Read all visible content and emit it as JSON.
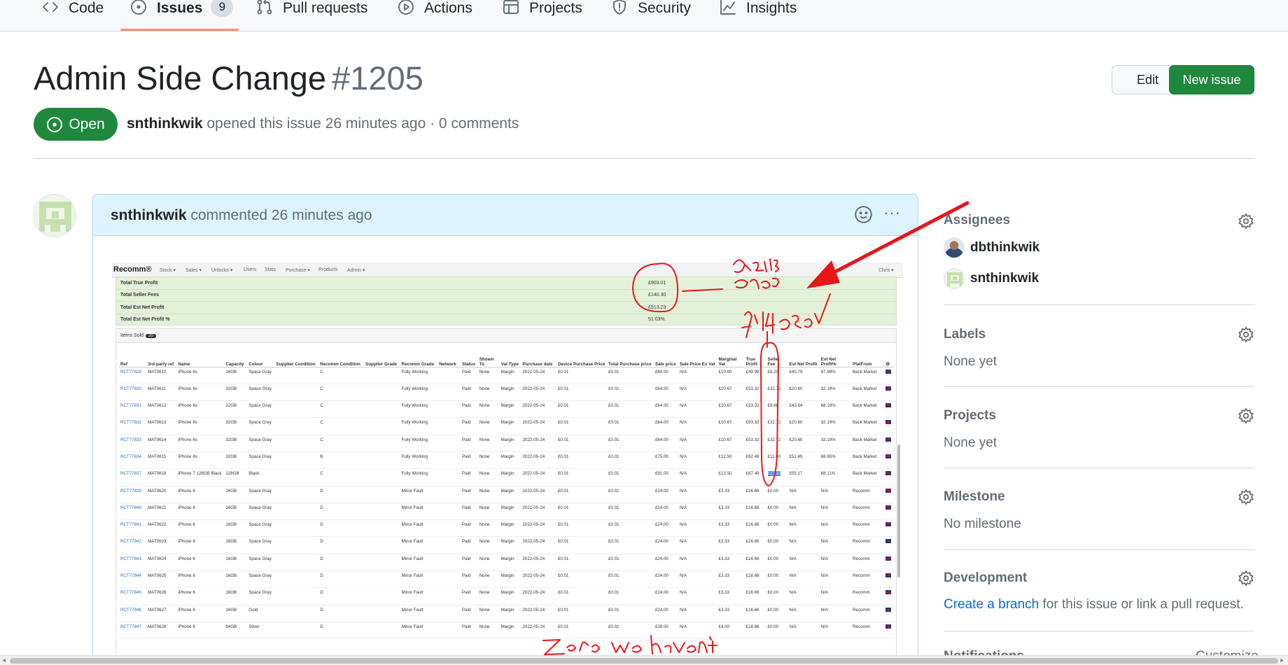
{
  "nav": {
    "tabs": [
      {
        "label": "Code",
        "icon": "code-icon"
      },
      {
        "label": "Issues",
        "icon": "issue-opened-icon",
        "count": "9",
        "active": true
      },
      {
        "label": "Pull requests",
        "icon": "git-pull-request-icon"
      },
      {
        "label": "Actions",
        "icon": "play-icon"
      },
      {
        "label": "Projects",
        "icon": "table-icon"
      },
      {
        "label": "Security",
        "icon": "shield-icon"
      },
      {
        "label": "Insights",
        "icon": "graph-icon"
      }
    ]
  },
  "issue": {
    "title": "Admin Side Change",
    "number": "#1205",
    "state": "Open",
    "author": "snthinkwik",
    "meta": "opened this issue 26 minutes ago · 0 comments",
    "edit_label": "Edit",
    "new_issue_label": "New issue"
  },
  "comment": {
    "author": "snthinkwik",
    "meta": "commented 26 minutes ago",
    "more": "···"
  },
  "screenshot": {
    "brand": "Recomm®",
    "nav": [
      "Stock ▾",
      "Sales ▾",
      "Unlocks ▾",
      "Users",
      "Stats",
      "Purchase ▾",
      "Products",
      "Admin ▾"
    ],
    "user": "Chris ▾",
    "summary": [
      {
        "label": "Total True Profit",
        "value": "£903.01"
      },
      {
        "label": "Total Seller Fees",
        "value": "£140.30"
      },
      {
        "label": "Total Est Net Profit",
        "value": "£513.23"
      },
      {
        "label": "Total Est Net Profit %",
        "value": "51.03%"
      }
    ],
    "items_title": "Items Sold",
    "items_count": "20",
    "columns": [
      "Ref",
      "3rd-party ref",
      "Name",
      "Capacity",
      "Colour",
      "Supplier Condition",
      "Recomm Condition",
      "Supplier Grade",
      "Recomm Grade",
      "Network",
      "Status",
      "Shown To",
      "Vat Type",
      "Purchase date",
      "Device Purchase Price",
      "Total Purchase price",
      "Sale price",
      "Sale Price Ex Vat",
      "Marginal Vat",
      "True Profit",
      "Seller Fee",
      "Est Net Profit",
      "Est Net Profit%",
      "PlatFrom",
      "⚙"
    ],
    "rows": [
      [
        "RCT77829",
        "MAT0610",
        "iPhone 6s",
        "16GB",
        "Space Gray",
        "",
        "C",
        "",
        "Fully Working",
        "",
        "Paid",
        "None",
        "Margin",
        "2022-05-24",
        "£0.01",
        "£0.01",
        "£60.00",
        "N/A",
        "£10.00",
        "£49.99",
        "£9.20",
        "£40.79",
        "67.98%",
        "Back Market"
      ],
      [
        "RCT77830",
        "MAT0611",
        "iPhone 6s",
        "32GB",
        "Space Gray",
        "",
        "C",
        "",
        "Fully Working",
        "",
        "Paid",
        "None",
        "Margin",
        "2022-05-24",
        "£0.01",
        "£0.01",
        "£64.00",
        "N/A",
        "£10.67",
        "£53.32",
        "£32.72",
        "£20.60",
        "32.19%",
        "Back Market"
      ],
      [
        "RCT77831",
        "MAT0612",
        "iPhone 6s",
        "32GB",
        "Space Gray",
        "",
        "C",
        "",
        "Fully Working",
        "",
        "Paid",
        "None",
        "Margin",
        "2022-05-24",
        "£0.01",
        "£0.01",
        "£64.00",
        "N/A",
        "£10.67",
        "£53.32",
        "£9.68",
        "£43.64",
        "68.19%",
        "Back Market"
      ],
      [
        "RCT77832",
        "MAT0613",
        "iPhone 6s",
        "32GB",
        "Space Gray",
        "",
        "C",
        "",
        "Fully Working",
        "",
        "Paid",
        "None",
        "Margin",
        "2022-05-24",
        "£0.01",
        "£0.01",
        "£64.00",
        "N/A",
        "£10.67",
        "£53.32",
        "£32.72",
        "£20.60",
        "32.19%",
        "Back Market"
      ],
      [
        "RCT77833",
        "MAT0614",
        "iPhone 6s",
        "32GB",
        "Space Gray",
        "",
        "C",
        "",
        "Fully Working",
        "",
        "Paid",
        "None",
        "Margin",
        "2022-05-24",
        "£0.01",
        "£0.01",
        "£64.00",
        "N/A",
        "£10.67",
        "£53.32",
        "£32.72",
        "£20.60",
        "32.19%",
        "Back Market"
      ],
      [
        "RCT77834",
        "MAT0615",
        "iPhone 6s",
        "32GB",
        "Space Gray",
        "",
        "B",
        "",
        "Fully Working",
        "",
        "Paid",
        "None",
        "Margin",
        "2022-05-24",
        "£0.01",
        "£0.01",
        "£75.00",
        "N/A",
        "£12.50",
        "£62.49",
        "£11.00",
        "£51.49",
        "68.65%",
        "Back Market"
      ],
      [
        "RCT77837",
        "MAT0618",
        "iPhone 7 128GB Black",
        "128GB",
        "Black",
        "",
        "C",
        "",
        "Fully Working",
        "",
        "Paid",
        "None",
        "Margin",
        "2022-05-24",
        "£0.01",
        "£0.01",
        "£81.00",
        "N/A",
        "£13.50",
        "£67.49",
        "£12.32",
        "£55.17",
        "68.11%",
        "Back Market"
      ],
      [
        "RCT77839",
        "MAT0620",
        "iPhone 6",
        "16GB",
        "Space Gray",
        "",
        "D",
        "",
        "Minor Fault",
        "",
        "Paid",
        "None",
        "Margin",
        "2022-05-24",
        "£0.01",
        "£0.01",
        "£24.00",
        "N/A",
        "£3.33",
        "£16.66",
        "£0.00",
        "N/A",
        "N/A",
        "Recomm"
      ],
      [
        "RCT77840",
        "MAT0621",
        "iPhone 6",
        "16GB",
        "Space Gray",
        "",
        "D",
        "",
        "Minor Fault",
        "",
        "Paid",
        "None",
        "Margin",
        "2022-05-24",
        "£0.01",
        "£0.01",
        "£24.00",
        "N/A",
        "£3.33",
        "£16.66",
        "£0.00",
        "N/A",
        "N/A",
        "Recomm"
      ],
      [
        "RCT77841",
        "MAT0622",
        "iPhone 6",
        "16GB",
        "Space Gray",
        "",
        "D",
        "",
        "Minor Fault",
        "",
        "Paid",
        "None",
        "Margin",
        "2022-05-24",
        "£0.01",
        "£0.01",
        "£24.00",
        "N/A",
        "£3.33",
        "£16.66",
        "£0.00",
        "N/A",
        "N/A",
        "Recomm"
      ],
      [
        "RCT77842",
        "MAT0623",
        "iPhone 6",
        "16GB",
        "Space Gray",
        "",
        "D",
        "",
        "Minor Fault",
        "",
        "Paid",
        "None",
        "Margin",
        "2022-05-24",
        "£0.01",
        "£0.01",
        "£24.00",
        "N/A",
        "£3.33",
        "£16.66",
        "£0.00",
        "N/A",
        "N/A",
        "Recomm"
      ],
      [
        "RCT77843",
        "MAT0624",
        "iPhone 6",
        "16GB",
        "Space Gray",
        "",
        "D",
        "",
        "Minor Fault",
        "",
        "Paid",
        "None",
        "Margin",
        "2022-05-24",
        "£0.01",
        "£0.01",
        "£24.00",
        "N/A",
        "£3.33",
        "£16.66",
        "£0.00",
        "N/A",
        "N/A",
        "Recomm"
      ],
      [
        "RCT77844",
        "MAT0625",
        "iPhone 6",
        "16GB",
        "Space Gray",
        "",
        "D",
        "",
        "Minor Fault",
        "",
        "Paid",
        "None",
        "Margin",
        "2022-05-24",
        "£0.01",
        "£0.01",
        "£24.00",
        "N/A",
        "£3.33",
        "£16.66",
        "£0.00",
        "N/A",
        "N/A",
        "Recomm"
      ],
      [
        "RCT77845",
        "MAT0626",
        "iPhone 6",
        "16GB",
        "Space Gray",
        "",
        "D",
        "",
        "Minor Fault",
        "",
        "Paid",
        "None",
        "Margin",
        "2022-05-24",
        "£0.01",
        "£0.01",
        "£24.00",
        "N/A",
        "£3.33",
        "£16.66",
        "£0.00",
        "N/A",
        "N/A",
        "Recomm"
      ],
      [
        "RCT77846",
        "MAT0627",
        "iPhone 6",
        "16GB",
        "Gold",
        "",
        "D",
        "",
        "Minor Fault",
        "",
        "Paid",
        "None",
        "Margin",
        "2022-05-24",
        "£0.01",
        "£0.01",
        "£24.00",
        "N/A",
        "£3.33",
        "£16.66",
        "£0.00",
        "N/A",
        "N/A",
        "Recomm"
      ],
      [
        "RCT77847",
        "MAT0628",
        "iPhone 6",
        "64GB",
        "Silver",
        "",
        "D",
        "",
        "Minor Fault",
        "",
        "Paid",
        "None",
        "Margin",
        "2022-05-24",
        "£0.01",
        "£0.01",
        "£28.00",
        "N/A",
        "£4.00",
        "£18.66",
        "£0.00",
        "N/A",
        "N/A",
        "Recomm"
      ]
    ],
    "highlight_text": "12.32",
    "annotations": [
      "doesn't add up",
      "£140.36",
      "Zero we haven't"
    ]
  },
  "sidebar": {
    "assignees_title": "Assignees",
    "assignees": [
      "dbthinkwik",
      "snthinkwik"
    ],
    "labels_title": "Labels",
    "labels_value": "None yet",
    "projects_title": "Projects",
    "projects_value": "None yet",
    "milestone_title": "Milestone",
    "milestone_value": "No milestone",
    "development_title": "Development",
    "development_link": "Create a branch",
    "development_rest": " for this issue or link a pull request.",
    "notifications_title": "Notifications",
    "notifications_action": "Customize"
  },
  "colors": {
    "accent_green": "#1f883d",
    "link_blue": "#0969da",
    "active_underline": "#fd8c73",
    "comment_header": "#ddf4ff",
    "annotation_red": "#e8151b"
  }
}
